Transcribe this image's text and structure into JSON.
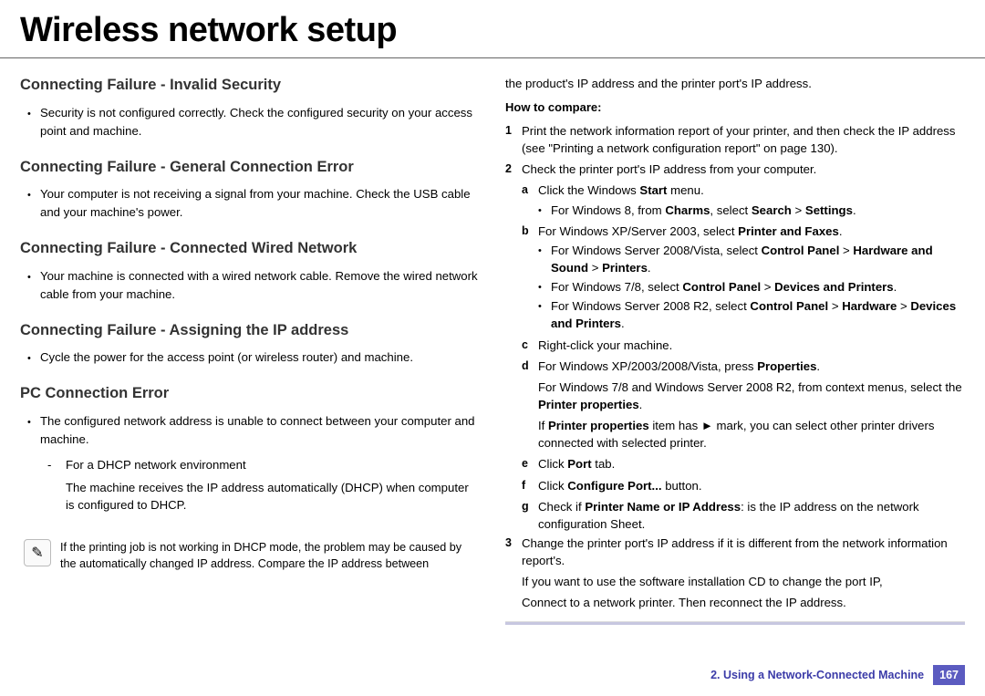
{
  "title": "Wireless network setup",
  "left": {
    "sections": [
      {
        "heading": "Connecting Failure - Invalid Security",
        "bullet": "Security is not configured correctly. Check the configured security on your access point and machine."
      },
      {
        "heading": "Connecting Failure - General Connection Error",
        "bullet": "Your computer is not receiving a signal from your machine. Check the USB cable and your machine's power."
      },
      {
        "heading": "Connecting Failure - Connected Wired Network",
        "bullet": "Your machine is connected with a wired network cable. Remove the wired network cable from your machine."
      },
      {
        "heading": "Connecting Failure - Assigning the IP address",
        "bullet": "Cycle the power for the access point (or wireless router) and machine."
      },
      {
        "heading": "PC Connection Error",
        "bullet": "The configured network address is unable to connect between your computer and machine.",
        "dash_label": "For a DHCP network environment",
        "dash_para": "The machine receives the IP address automatically (DHCP) when computer is configured to DHCP."
      }
    ],
    "note": "If the printing job is not working in DHCP mode, the problem may be caused by the automatically changed IP address. Compare the IP address between"
  },
  "right": {
    "lead": "the product's IP address and the printer port's IP address.",
    "howto": "How to compare:",
    "step1": "Print the network information report of your printer, and then check the IP address (see \"Printing a network configuration report\" on page 130).",
    "step2": "Check the printer port's IP address from your computer.",
    "a_pre": "Click the Windows ",
    "a_b": "Start",
    "a_post": " menu.",
    "a_sub_pre": "For Windows 8, from ",
    "a_sub_b1": "Charms",
    "a_sub_mid": ", select ",
    "a_sub_b2": "Search",
    "a_sub_gt": " > ",
    "a_sub_b3": "Settings",
    "a_sub_post": ".",
    "b_pre": "For Windows XP/Server 2003, select ",
    "b_b": "Printer and Faxes",
    "b_post": ".",
    "b_s1_pre": "For Windows Server 2008/Vista, select ",
    "b_s1_b1": "Control Panel",
    "b_s1_b2": "Hardware and Sound",
    "b_s1_b3": "Printers",
    "b_s2_pre": "For Windows 7/8, select ",
    "b_s2_b1": "Control Panel",
    "b_s2_b2": "Devices and Printers",
    "b_s3_pre": "For Windows Server 2008 R2, select ",
    "b_s3_b1": "Control Panel",
    "b_s3_b2": "Hardware",
    "b_s3_b3": "Devices and Printers",
    "c": "Right-click your machine.",
    "d_pre": "For Windows XP/2003/2008/Vista, press ",
    "d_b": "Properties",
    "d_post": ".",
    "d_p2_pre": "For Windows 7/8 and Windows Server 2008 R2, from context menus, select the ",
    "d_p2_b": "Printer properties",
    "d_p2_post": ".",
    "d_p3_pre": "If ",
    "d_p3_b": "Printer properties",
    "d_p3_mid": " item has ► mark, you can select other printer drivers connected with selected printer.",
    "e_pre": "Click ",
    "e_b": "Port",
    "e_post": " tab.",
    "f_pre": "Click ",
    "f_b": "Configure Port...",
    "f_post": " button.",
    "g_pre": "Check if ",
    "g_b": "Printer Name or IP Address",
    "g_post": ": is the IP address on the network configuration Sheet.",
    "step3": "Change the printer port's IP address if it is different from the network information report's.",
    "tail1": "If you  want to use the software installation CD to change the port IP,",
    "tail2": "Connect to a network printer. Then reconnect the IP address."
  },
  "footer": {
    "chapter": "2.  Using a Network-Connected Machine",
    "page": "167"
  }
}
